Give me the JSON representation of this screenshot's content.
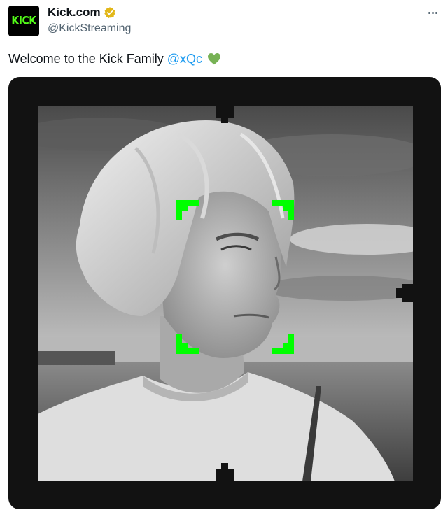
{
  "account": {
    "avatar_text": "KICK",
    "display_name": "Kick.com",
    "handle": "@KickStreaming",
    "verified_badge_color": "#e2b719",
    "avatar_color": "#000000",
    "avatar_text_color": "#53fc18"
  },
  "tweet": {
    "text": "Welcome to the Kick Family",
    "mention": "@xQc",
    "emoji": "green-heart"
  },
  "media": {
    "frame_color": "#121212",
    "accent_color": "#00ff00",
    "image_style": "black-and-white portrait"
  },
  "icons": {
    "more": "more-horizontal-icon",
    "verified": "verified-badge-icon",
    "heart": "green-heart-icon"
  }
}
